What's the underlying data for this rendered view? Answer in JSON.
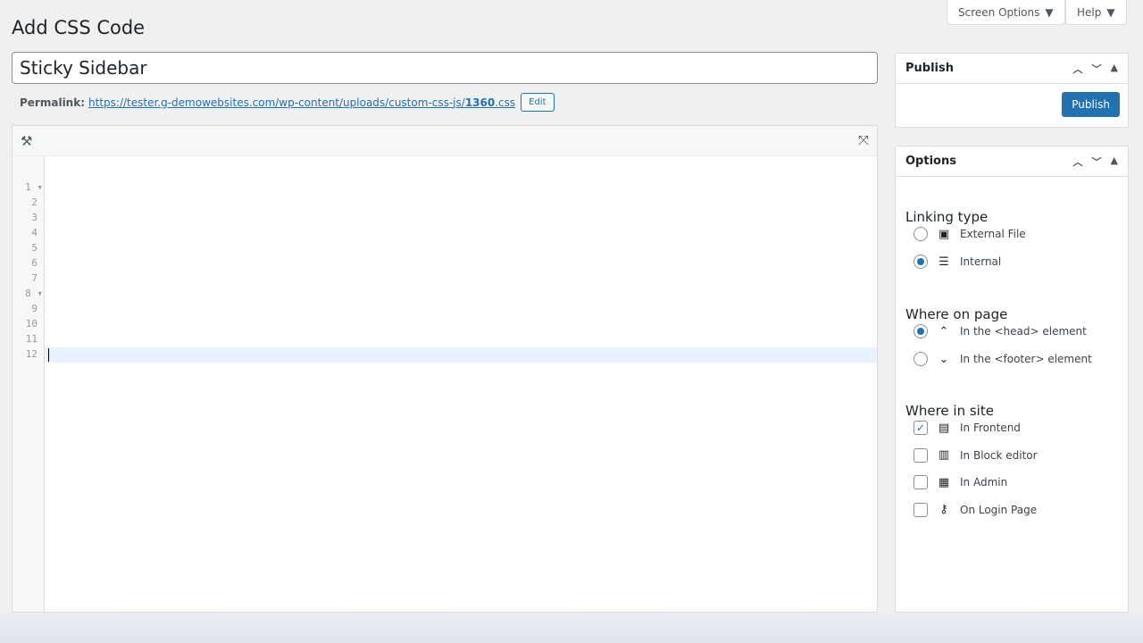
{
  "header": {
    "screen_options": "Screen Options",
    "help": "Help",
    "title": "Add CSS Code"
  },
  "post": {
    "title": "Sticky Sidebar",
    "permalink_label": "Permalink:",
    "permalink_url": "https://tester.g-demowebsites.com/wp-content/uploads/custom-css-js/",
    "permalink_slug": "1360",
    "permalink_ext": ".css",
    "edit_label": "Edit"
  },
  "editor": {
    "line_numbers": [
      "1",
      "2",
      "3",
      "4",
      "5",
      "6",
      "7",
      "8",
      "9",
      "10",
      "11",
      "12"
    ],
    "folded_lines": [
      "1",
      "8"
    ],
    "active_line": "12"
  },
  "publish": {
    "title": "Publish",
    "button": "Publish"
  },
  "options": {
    "title": "Options",
    "linking_type": {
      "label": "Linking type",
      "items": [
        {
          "label": "External File",
          "icon": "file-code-icon",
          "checked": false
        },
        {
          "label": "Internal",
          "icon": "text-lines-icon",
          "checked": true
        }
      ]
    },
    "where_on_page": {
      "label": "Where on page",
      "items": [
        {
          "label": "In the <head> element",
          "icon": "chevron-up-icon",
          "checked": true
        },
        {
          "label": "In the <footer> element",
          "icon": "chevron-down-icon",
          "checked": false
        }
      ]
    },
    "where_in_site": {
      "label": "Where in site",
      "items": [
        {
          "label": "In Frontend",
          "icon": "layout-icon",
          "checked": true
        },
        {
          "label": "In Block editor",
          "icon": "block-icon",
          "checked": false
        },
        {
          "label": "In Admin",
          "icon": "admin-icon",
          "checked": false
        },
        {
          "label": "On Login Page",
          "icon": "key-icon",
          "checked": false
        }
      ]
    }
  },
  "colors": {
    "accent": "#2271b1"
  }
}
